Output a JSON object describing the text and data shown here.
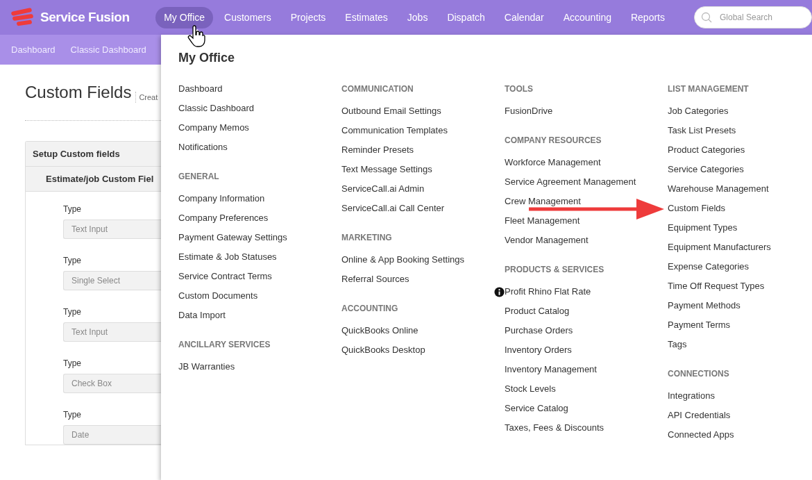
{
  "header": {
    "brand": "Service Fusion",
    "nav": [
      {
        "label": "My Office",
        "selected": true
      },
      {
        "label": "Customers",
        "selected": false
      },
      {
        "label": "Projects",
        "selected": false
      },
      {
        "label": "Estimates",
        "selected": false
      },
      {
        "label": "Jobs",
        "selected": false
      },
      {
        "label": "Dispatch",
        "selected": false
      },
      {
        "label": "Calendar",
        "selected": false
      },
      {
        "label": "Accounting",
        "selected": false
      },
      {
        "label": "Reports",
        "selected": false
      }
    ],
    "search": {
      "placeholder": "Global Search"
    }
  },
  "subnav": [
    "Dashboard",
    "Classic Dashboard"
  ],
  "page": {
    "title": "Custom Fields",
    "subtitle": "Creat",
    "panel_title": "Setup Custom fields",
    "section_title": "Estimate/job Custom Fiel",
    "fields": [
      {
        "label": "Type",
        "value": "Text Input"
      },
      {
        "label": "Type",
        "value": "Single Select"
      },
      {
        "label": "Type",
        "value": "Text Input"
      },
      {
        "label": "Type",
        "value": "Check Box"
      },
      {
        "label": "Type",
        "value": "Date"
      }
    ]
  },
  "menu": {
    "title": "My Office",
    "columns": [
      {
        "sections": [
          {
            "items": [
              {
                "label": "Dashboard",
                "kind": "link"
              },
              {
                "label": "Classic Dashboard",
                "kind": "link"
              },
              {
                "label": "Company Memos",
                "kind": "link"
              },
              {
                "label": "Notifications",
                "kind": "link"
              }
            ]
          },
          {
            "heading": "GENERAL",
            "items": [
              {
                "label": "Company Information",
                "kind": "link"
              },
              {
                "label": "Company Preferences",
                "kind": "link"
              },
              {
                "label": "Payment Gateway Settings",
                "kind": "link"
              },
              {
                "label": "Estimate & Job Statuses",
                "kind": "link"
              },
              {
                "label": "Service Contract Terms",
                "kind": "link"
              },
              {
                "label": "Custom Documents",
                "kind": "link"
              },
              {
                "label": "Data Import",
                "kind": "link"
              }
            ]
          },
          {
            "heading": "ANCILLARY SERVICES",
            "items": [
              {
                "label": "JB Warranties",
                "kind": "link"
              }
            ]
          }
        ]
      },
      {
        "sections": [
          {
            "heading": "COMMUNICATION",
            "items": [
              {
                "label": "Outbound Email Settings",
                "kind": "link"
              },
              {
                "label": "Communication Templates",
                "kind": "link"
              },
              {
                "label": "Reminder Presets",
                "kind": "link"
              },
              {
                "label": "Text Message Settings",
                "kind": "link"
              },
              {
                "label": "ServiceCall.ai Admin",
                "kind": "link"
              },
              {
                "label": "ServiceCall.ai Call Center",
                "kind": "link"
              }
            ]
          },
          {
            "heading": "MARKETING",
            "items": [
              {
                "label": "Online & App Booking Settings",
                "kind": "link"
              },
              {
                "label": "Referral Sources",
                "kind": "link"
              }
            ]
          },
          {
            "heading": "ACCOUNTING",
            "items": [
              {
                "label": "QuickBooks Online",
                "kind": "link"
              },
              {
                "label": "QuickBooks Desktop",
                "kind": "link"
              }
            ]
          }
        ]
      },
      {
        "sections": [
          {
            "heading": "TOOLS",
            "items": [
              {
                "label": "FusionDrive",
                "kind": "link"
              }
            ]
          },
          {
            "heading": "COMPANY RESOURCES",
            "items": [
              {
                "label": "Workforce Management",
                "kind": "link"
              },
              {
                "label": "Service Agreement Management",
                "kind": "link"
              },
              {
                "label": "Crew Management",
                "kind": "link"
              },
              {
                "label": "Fleet Management",
                "kind": "link"
              },
              {
                "label": "Vendor Management",
                "kind": "link"
              }
            ]
          },
          {
            "heading": "PRODUCTS & SERVICES",
            "items": [
              {
                "label": "Profit Rhino Flat Rate",
                "kind": "info"
              },
              {
                "label": "Product Catalog",
                "kind": "link"
              },
              {
                "label": "Purchase Orders",
                "kind": "link"
              },
              {
                "label": "Inventory Orders",
                "kind": "link"
              },
              {
                "label": "Inventory Management",
                "kind": "link"
              },
              {
                "label": "Stock Levels",
                "kind": "link"
              },
              {
                "label": "Service Catalog",
                "kind": "link"
              },
              {
                "label": "Taxes, Fees & Discounts",
                "kind": "link"
              }
            ]
          }
        ]
      },
      {
        "sections": [
          {
            "heading": "LIST MANAGEMENT",
            "items": [
              {
                "label": "Job Categories",
                "kind": "link"
              },
              {
                "label": "Task List Presets",
                "kind": "link"
              },
              {
                "label": "Product Categories",
                "kind": "link"
              },
              {
                "label": "Service Categories",
                "kind": "link"
              },
              {
                "label": "Warehouse Management",
                "kind": "link"
              },
              {
                "label": "Custom Fields",
                "kind": "link"
              },
              {
                "label": "Equipment Types",
                "kind": "link"
              },
              {
                "label": "Equipment Manufacturers",
                "kind": "link"
              },
              {
                "label": "Expense Categories",
                "kind": "link"
              },
              {
                "label": "Time Off Request Types",
                "kind": "link"
              },
              {
                "label": "Payment Methods",
                "kind": "link"
              },
              {
                "label": "Payment Terms",
                "kind": "link"
              },
              {
                "label": "Tags",
                "kind": "link"
              }
            ]
          },
          {
            "heading": "CONNECTIONS",
            "items": [
              {
                "label": "Integrations",
                "kind": "link"
              },
              {
                "label": "API Credentials",
                "kind": "link"
              },
              {
                "label": "Connected Apps",
                "kind": "link"
              }
            ]
          }
        ]
      }
    ]
  }
}
